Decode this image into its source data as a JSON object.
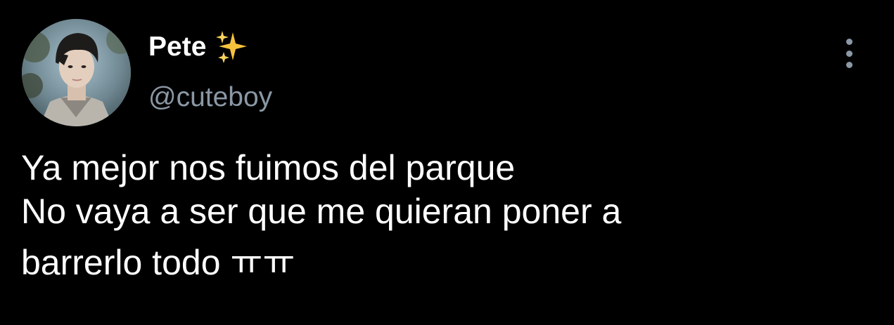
{
  "author": {
    "display_name": "Pete",
    "emoji": "sparkles-emoji",
    "handle": "@cuteboy"
  },
  "tweet": {
    "lines": [
      "Ya mejor nos fuimos del parque",
      "No vaya a ser que me quieran poner a",
      "barrerlo todo ㅠㅠ"
    ]
  },
  "icons": {
    "more": "more-vertical-icon",
    "avatar": "avatar"
  },
  "colors": {
    "background": "#000000",
    "text": "#ffffff",
    "secondary": "#8b98a5",
    "sparkle": "#f6c23e"
  }
}
